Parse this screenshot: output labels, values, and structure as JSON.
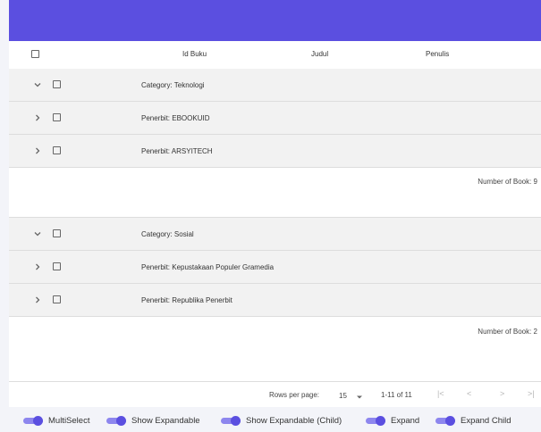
{
  "table": {
    "headers": {
      "id": "Id Buku",
      "title": "Judul",
      "author": "Penulis"
    },
    "groups": [
      {
        "label": "Category: Teknologi",
        "children": [
          "Penerbit: EBOOKUID",
          "Penerbit: ARSYITECH"
        ],
        "summary": "Number of Book: 9"
      },
      {
        "label": "Category: Sosial",
        "children": [
          "Penerbit: Kepustakaan Populer Gramedia",
          "Penerbit: Republika Penerbit"
        ],
        "summary": "Number of Book: 2"
      }
    ]
  },
  "pagination": {
    "rows_per_page_label": "Rows per page:",
    "rows_per_page_value": "15",
    "range": "1-11 of 11"
  },
  "toggles": [
    {
      "label": "MultiSelect",
      "on": true
    },
    {
      "label": "Show Expandable",
      "on": true
    },
    {
      "label": "Show Expandable (Child)",
      "on": true
    },
    {
      "label": "Expand",
      "on": true
    },
    {
      "label": "Expand Child",
      "on": true
    }
  ],
  "colors": {
    "accent": "#5b4fe0",
    "track": "#8d86ee",
    "group_row": "#f2f2f2"
  }
}
